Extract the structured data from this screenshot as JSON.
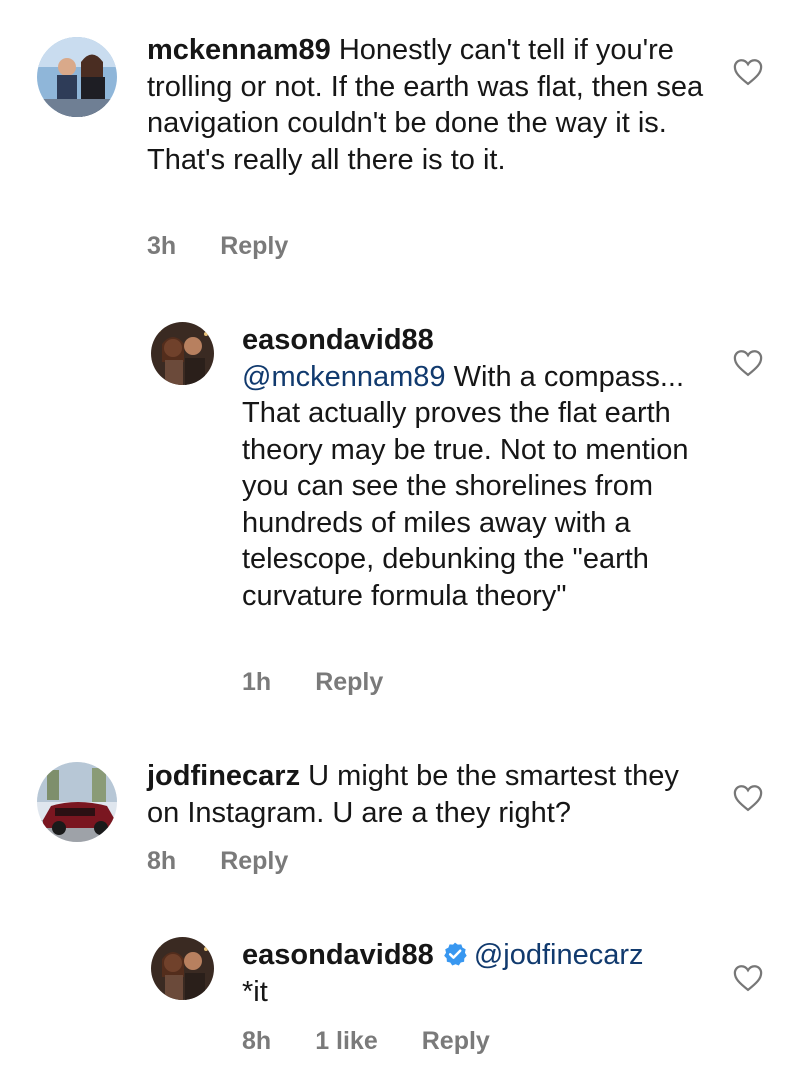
{
  "comments": [
    {
      "username": "mckennam89",
      "text": "Honestly can't tell if you're trolling or not. If the earth was flat, then sea navigation couldn't be done the way it is. That's really all there is to it.",
      "time": "3h",
      "reply_label": "Reply"
    },
    {
      "username": "easondavid88",
      "mention": "@mckennam89",
      "text": "With a compass... That actually proves the flat earth theory may be true. Not to mention you can see the shorelines from hundreds of miles away with a telescope, debunking the \"earth curvature formula theory\"",
      "time": "1h",
      "reply_label": "Reply"
    },
    {
      "username": "jodfinecarz",
      "text": "U might be the smartest they on Instagram. U are a they right?",
      "time": "8h",
      "reply_label": "Reply"
    },
    {
      "username": "easondavid88",
      "mention": "@jodfinecarz",
      "text": "*it",
      "time": "8h",
      "likes": "1 like",
      "reply_label": "Reply"
    }
  ],
  "colors": {
    "meta": "#7a7a7a",
    "mention": "#113a6e",
    "verified": "#3897f0"
  },
  "icons": {
    "like": "heart-outline-icon",
    "verified": "verified-badge-icon"
  }
}
